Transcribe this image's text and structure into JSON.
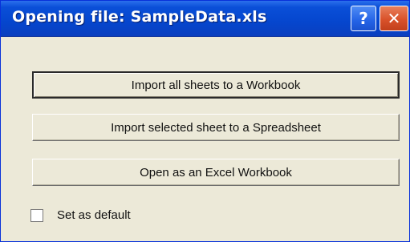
{
  "window": {
    "title": "Opening file:  SampleData.xls",
    "help_glyph": "?",
    "close_glyph": "✕"
  },
  "buttons": {
    "import_all": "Import all sheets to a Workbook",
    "import_selected": "Import selected sheet to a Spreadsheet",
    "open_excel": "Open as an Excel Workbook"
  },
  "default_option": {
    "label": "Set as default",
    "checked": false
  },
  "colors": {
    "titlebar": "#0546ce",
    "close_button": "#d9522a",
    "dialog_background": "#ece9d8"
  }
}
